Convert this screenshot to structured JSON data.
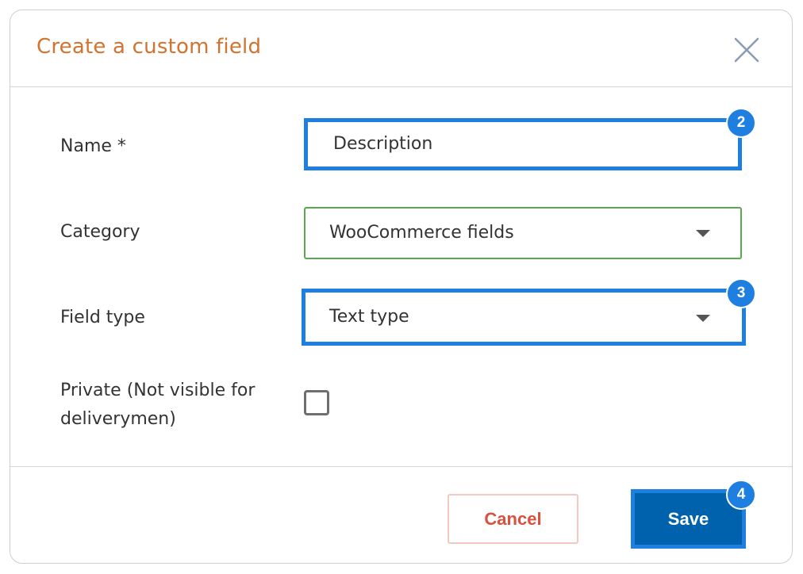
{
  "dialog": {
    "title": "Create a custom field",
    "close_icon": "close-icon"
  },
  "form": {
    "name": {
      "label": "Name *",
      "value": "Description"
    },
    "category": {
      "label": "Category",
      "selected": "WooCommerce fields",
      "icon": "caret-down-icon"
    },
    "field_type": {
      "label": "Field type",
      "selected": "Text type",
      "icon": "caret-down-icon"
    },
    "private": {
      "label_line1": "Private (Not visible for",
      "label_line2": "deliverymen)",
      "checked": false
    }
  },
  "footer": {
    "cancel_label": "Cancel",
    "save_label": "Save"
  },
  "annotations": {
    "badge_name": "2",
    "badge_field_type": "3",
    "badge_save": "4"
  },
  "colors": {
    "title": "#d2732f",
    "highlight": "#1e7fe0",
    "category_border": "#59a84f",
    "cancel_text": "#d9503f",
    "save_bg": "#0062ad"
  }
}
